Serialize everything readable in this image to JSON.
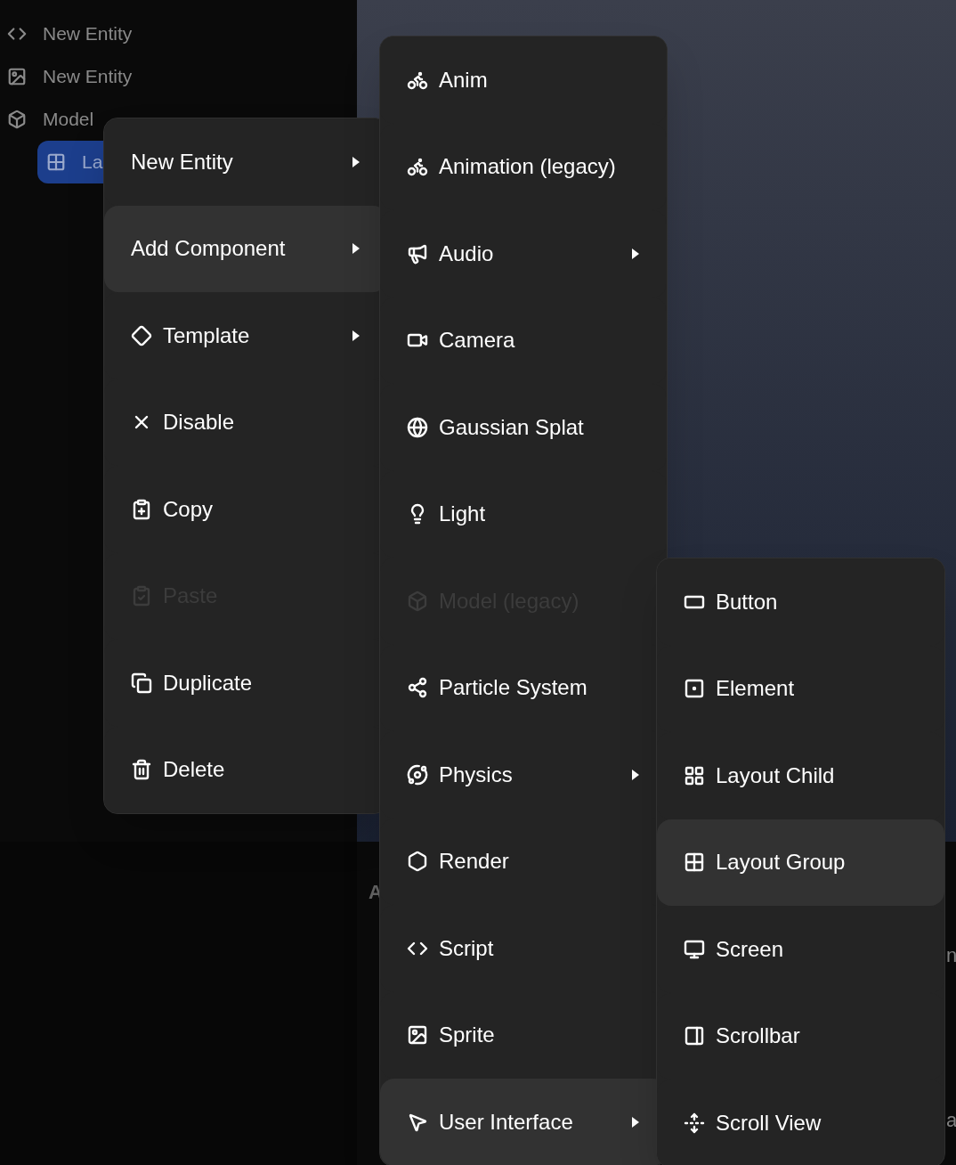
{
  "sidebar": {
    "items": [
      {
        "label": "New Entity",
        "selected": false
      },
      {
        "label": "New Entity",
        "selected": false
      },
      {
        "label": "Model",
        "selected": false
      },
      {
        "label": "La",
        "selected": true
      }
    ]
  },
  "background_fragments": [
    "A",
    "n",
    "a"
  ],
  "context_menu": {
    "items": [
      {
        "label": "New Entity",
        "submenu": true,
        "selected": false,
        "disabled": false
      },
      {
        "label": "Add Component",
        "submenu": true,
        "selected": true,
        "disabled": false
      },
      {
        "label": "Template",
        "submenu": true,
        "selected": false,
        "disabled": false
      },
      {
        "label": "Disable",
        "submenu": false,
        "selected": false,
        "disabled": false
      },
      {
        "label": "Copy",
        "submenu": false,
        "selected": false,
        "disabled": false
      },
      {
        "label": "Paste",
        "submenu": false,
        "selected": false,
        "disabled": true
      },
      {
        "label": "Duplicate",
        "submenu": false,
        "selected": false,
        "disabled": false
      },
      {
        "label": "Delete",
        "submenu": false,
        "selected": false,
        "disabled": false
      }
    ]
  },
  "component_menu": {
    "items": [
      {
        "label": "Anim",
        "submenu": false,
        "selected": false,
        "disabled": false
      },
      {
        "label": "Animation (legacy)",
        "submenu": false,
        "selected": false,
        "disabled": false
      },
      {
        "label": "Audio",
        "submenu": true,
        "selected": false,
        "disabled": false
      },
      {
        "label": "Camera",
        "submenu": false,
        "selected": false,
        "disabled": false
      },
      {
        "label": "Gaussian Splat",
        "submenu": false,
        "selected": false,
        "disabled": false
      },
      {
        "label": "Light",
        "submenu": false,
        "selected": false,
        "disabled": false
      },
      {
        "label": "Model (legacy)",
        "submenu": false,
        "selected": false,
        "disabled": true
      },
      {
        "label": "Particle System",
        "submenu": false,
        "selected": false,
        "disabled": false
      },
      {
        "label": "Physics",
        "submenu": true,
        "selected": false,
        "disabled": false
      },
      {
        "label": "Render",
        "submenu": false,
        "selected": false,
        "disabled": false
      },
      {
        "label": "Script",
        "submenu": false,
        "selected": false,
        "disabled": false
      },
      {
        "label": "Sprite",
        "submenu": false,
        "selected": false,
        "disabled": false
      },
      {
        "label": "User Interface",
        "submenu": true,
        "selected": true,
        "disabled": false
      }
    ]
  },
  "ui_menu": {
    "items": [
      {
        "label": "Button",
        "submenu": false,
        "selected": false,
        "disabled": false
      },
      {
        "label": "Element",
        "submenu": false,
        "selected": false,
        "disabled": false
      },
      {
        "label": "Layout Child",
        "submenu": false,
        "selected": false,
        "disabled": false
      },
      {
        "label": "Layout Group",
        "submenu": false,
        "selected": true,
        "disabled": false
      },
      {
        "label": "Screen",
        "submenu": false,
        "selected": false,
        "disabled": false
      },
      {
        "label": "Scrollbar",
        "submenu": false,
        "selected": false,
        "disabled": false
      },
      {
        "label": "Scroll View",
        "submenu": false,
        "selected": false,
        "disabled": false
      }
    ]
  }
}
